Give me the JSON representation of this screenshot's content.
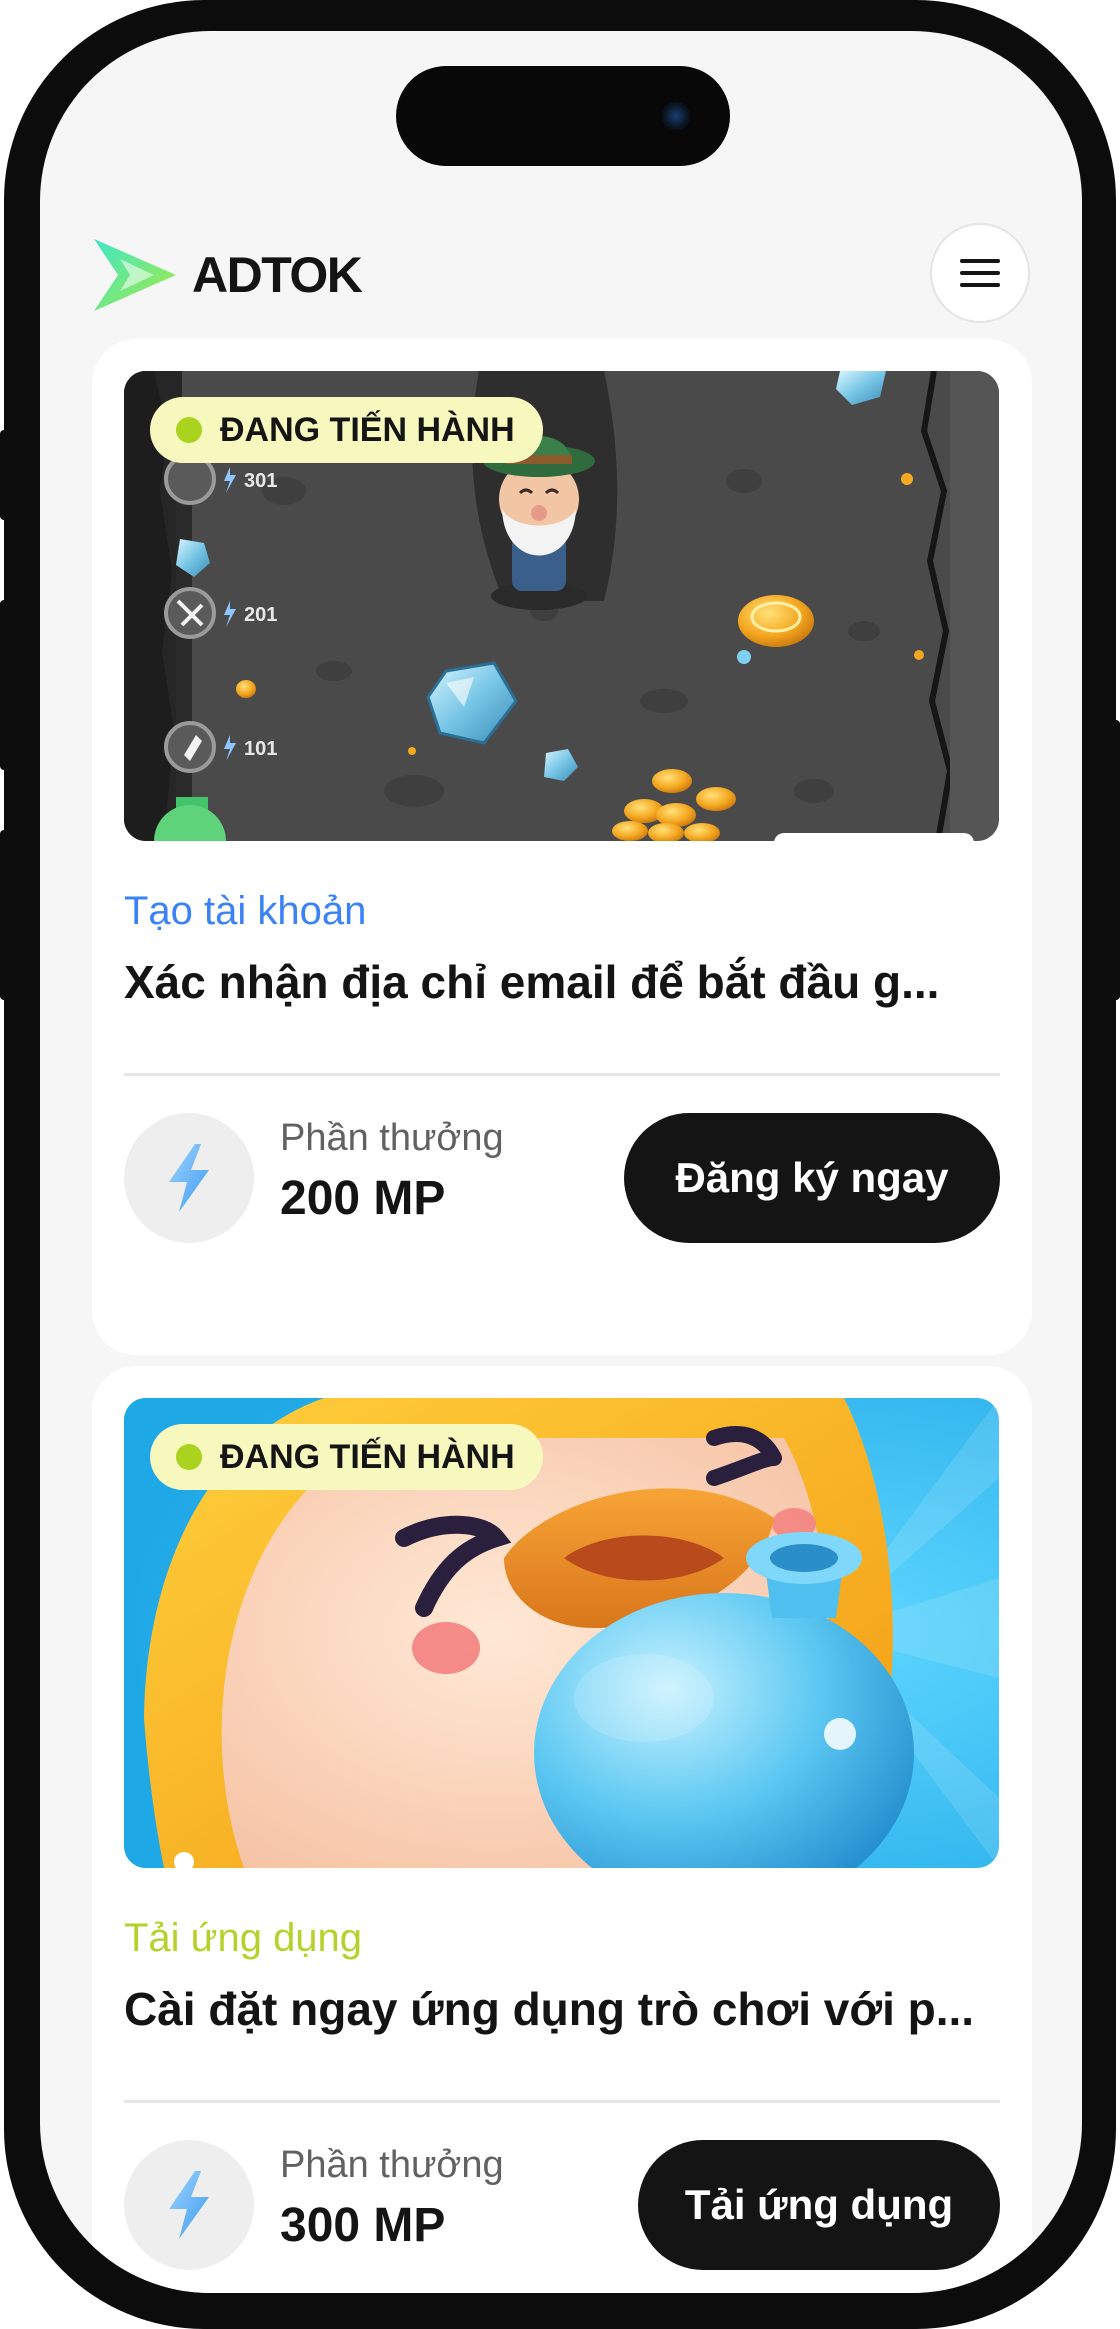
{
  "app": {
    "brand": "ADTOK"
  },
  "colors": {
    "accent_blue": "#3b82f6",
    "accent_green": "#b5d22a",
    "status_pill_bg": "#f6f8be",
    "status_dot": "#a9d31f",
    "button_bg": "#141414"
  },
  "icons": {
    "logo": "adtok-logo-icon",
    "menu": "hamburger-menu-icon",
    "reward": "lightning-bolt-icon"
  },
  "tasks": [
    {
      "status": "ĐANG TIẾN HÀNH",
      "category": "Tạo tài khoản",
      "category_color": "#3b82f6",
      "title": "Xác nhận địa chỉ email để bắt đầu g...",
      "reward_label": "Phần thưởng",
      "reward_value": "200 MP",
      "action_label": "Đăng ký ngay",
      "game_levels": [
        "301",
        "201",
        "101"
      ]
    },
    {
      "status": "ĐANG TIẾN HÀNH",
      "category": "Tải ứng dụng",
      "category_color": "#b5d22a",
      "title": "Cài đặt ngay ứng dụng trò chơi với p...",
      "reward_label": "Phần thưởng",
      "reward_value": "300 MP",
      "action_label": "Tải ứng dụng"
    }
  ]
}
